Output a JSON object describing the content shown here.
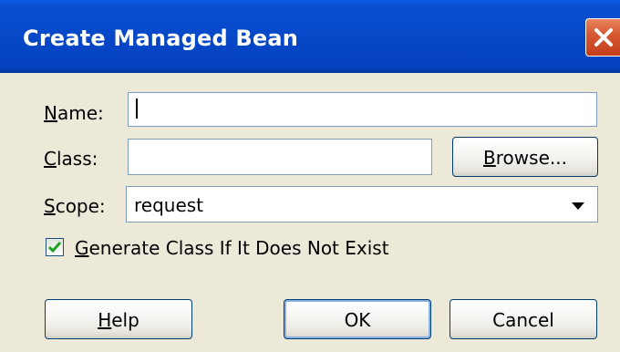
{
  "dialog": {
    "title": "Create Managed Bean"
  },
  "form": {
    "name_label_u": "N",
    "name_label_rest": "ame:",
    "name_value": "",
    "class_label_u": "C",
    "class_label_rest": "lass:",
    "class_value": "",
    "browse_label_u": "B",
    "browse_label_rest": "rowse...",
    "scope_label_u": "S",
    "scope_label_rest": "cope:",
    "scope_value": "request",
    "generate_label_u": "G",
    "generate_label_rest": "enerate Class If It Does Not Exist",
    "generate_checked": true
  },
  "buttons": {
    "help_u": "H",
    "help_rest": "elp",
    "ok": "OK",
    "cancel": "Cancel"
  },
  "colors": {
    "titlebar": "#0648c8",
    "dialog_bg": "#ece9d8",
    "close": "#c53d1a",
    "check": "#21a121"
  }
}
